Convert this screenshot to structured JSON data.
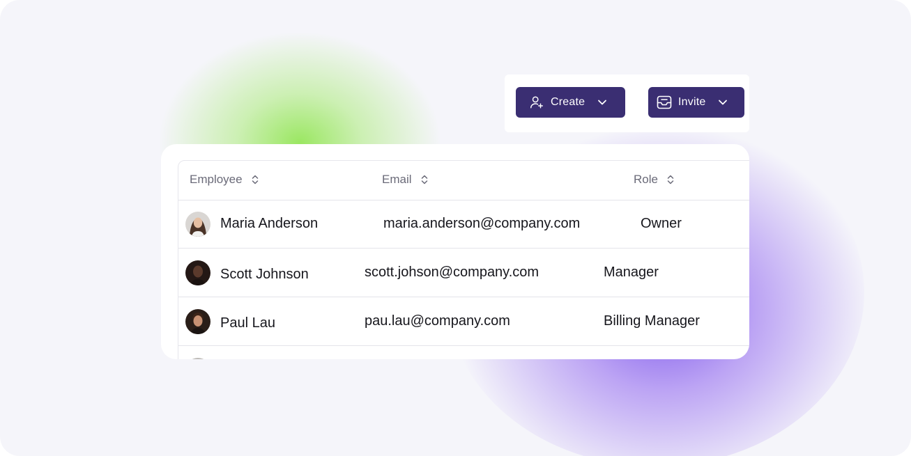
{
  "toolbar": {
    "create_label": "Create",
    "invite_label": "Invite",
    "create_icon": "add-user-icon",
    "invite_icon": "inbox-icon",
    "button_color": "#3a2e72"
  },
  "table": {
    "columns": [
      {
        "label": "Employee"
      },
      {
        "label": "Email"
      },
      {
        "label": "Role"
      }
    ],
    "rows": [
      {
        "name": "Maria Anderson",
        "email": "maria.anderson@company.com",
        "role": "Owner"
      },
      {
        "name": "Scott Johnson",
        "email": "scott.johson@company.com",
        "role": "Manager"
      },
      {
        "name": "Paul Lau",
        "email": "pau.lau@company.com",
        "role": "Billing Manager"
      }
    ]
  }
}
